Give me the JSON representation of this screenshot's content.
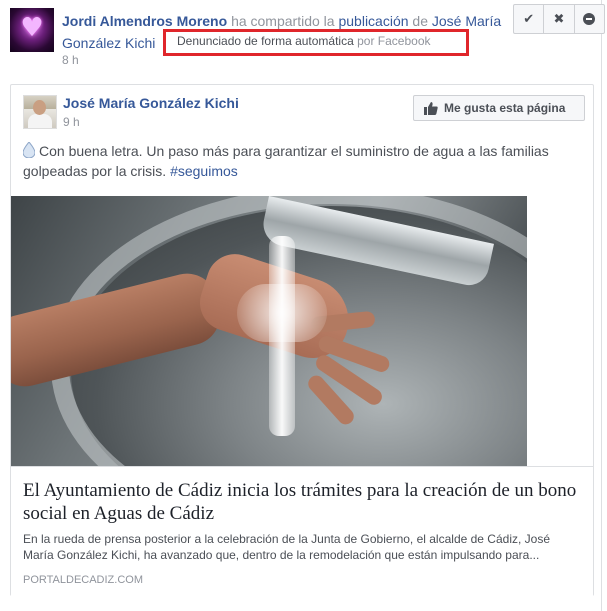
{
  "story": {
    "sharer": "Jordi Almendros Moreno",
    "action_text": "ha compartido la",
    "object_link": "publicación",
    "preposition": "de",
    "original_author_line1": "José María",
    "original_author_line2": "González Kichi",
    "timestamp": "8 h",
    "report_label": "Denunciado de forma automática",
    "report_suffix": "por Facebook"
  },
  "actions": {
    "check_icon": "check-icon",
    "close_icon": "close-icon",
    "minus_icon": "minus-circle-icon"
  },
  "post": {
    "page_name": "José María González Kichi",
    "timestamp": "9 h",
    "like_page_label": "Me gusta esta página",
    "text": "Con buena letra. Un paso más para garantizar el suministro de agua a las familias golpeadas por la crisis.",
    "hashtag": "#seguimos"
  },
  "link_preview": {
    "title": "El Ayuntamiento de Cádiz inicia los trámites para la creación de un bono social en Aguas de Cádiz",
    "description": "En la rueda de prensa posterior a la celebración de la Junta de Gobierno, el alcalde de Cádiz, José María González Kichi, ha avanzado que, dentro de la remodelación que están impulsando para...",
    "source": "PORTALDECADIZ.COM"
  },
  "colors": {
    "link_blue": "#365899",
    "report_box_red": "#e0262b",
    "meta_gray": "#90949c"
  }
}
